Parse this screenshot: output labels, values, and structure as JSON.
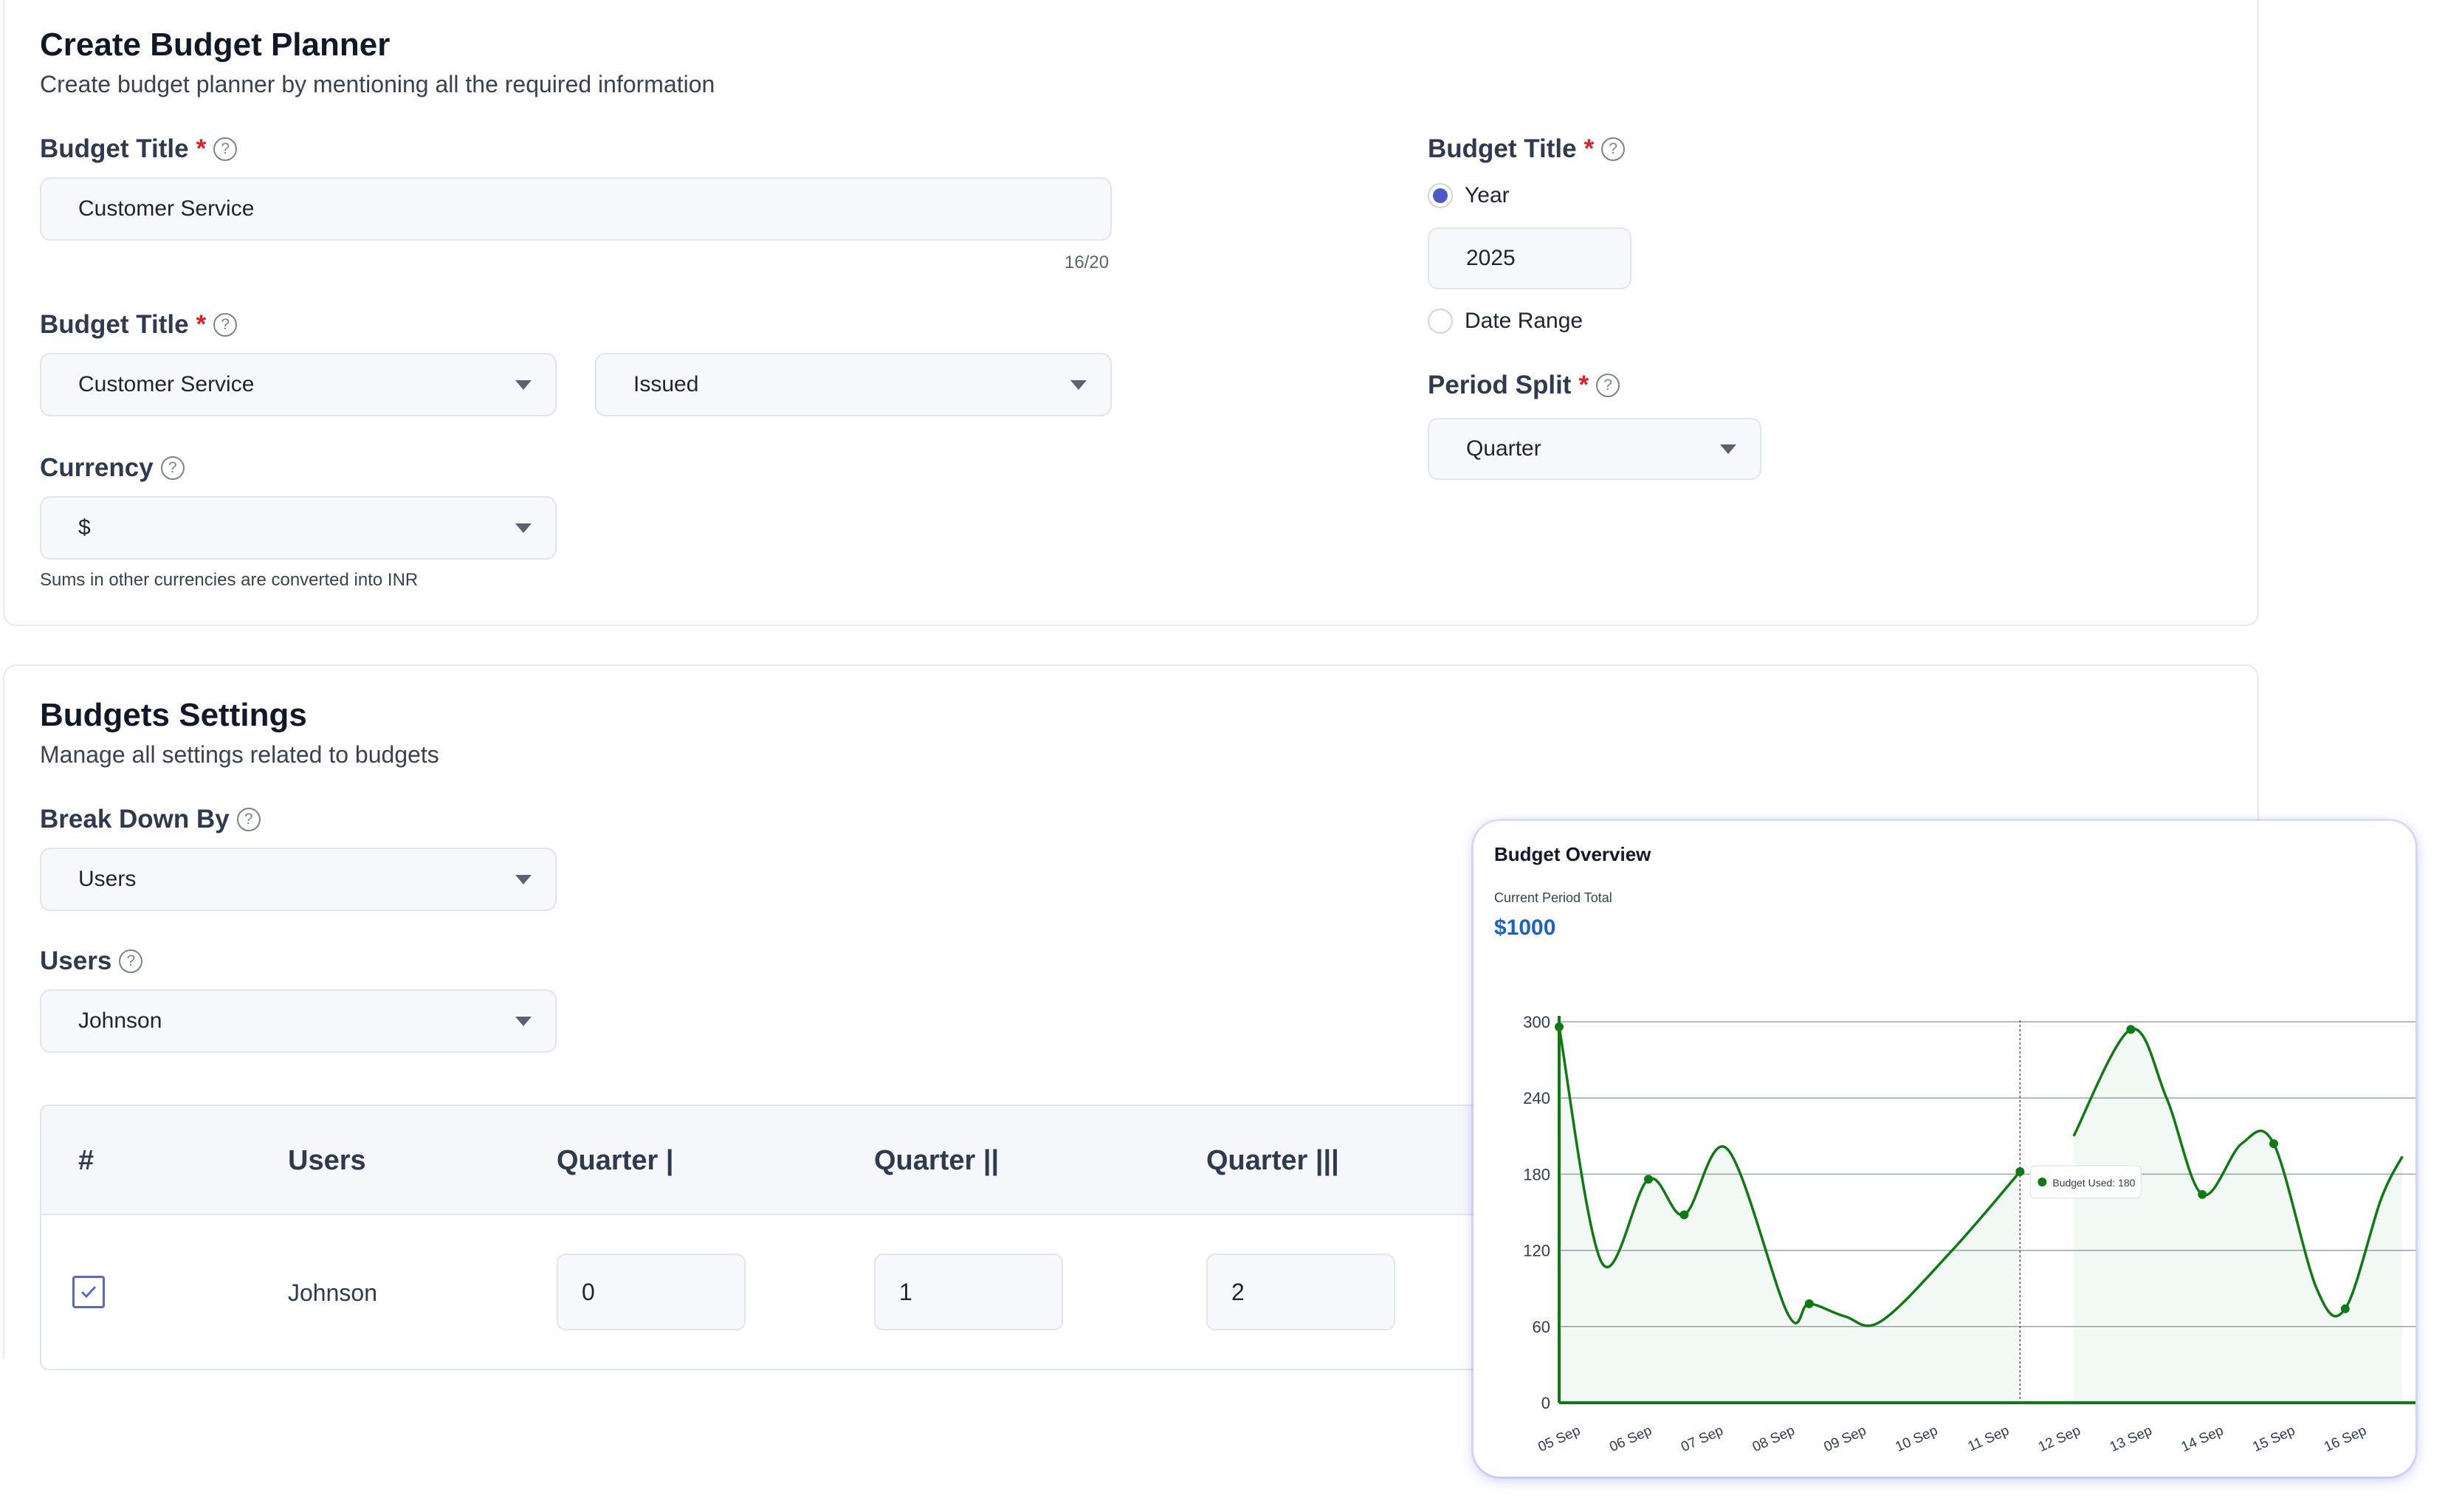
{
  "planner": {
    "title": "Create Budget Planner",
    "subtitle": "Create budget planner by mentioning all the required information",
    "budget_title_label": "Budget Title",
    "required_mark": "*",
    "help_glyph": "?",
    "budget_title_value": "Customer Service",
    "char_counter": "16/20",
    "budget_title2_label": "Budget Title",
    "department_select": "Customer Service",
    "status_select": "Issued",
    "currency_label": "Currency",
    "currency_select": "$",
    "currency_note": "Sums in other currencies are converted into INR",
    "right_title_label": "Budget Title",
    "radio_year_label": "Year",
    "year_value": "2025",
    "radio_range_label": "Date Range",
    "period_split_label": "Period Split",
    "period_split_select": "Quarter"
  },
  "settings": {
    "title": "Budgets Settings",
    "subtitle": "Manage all settings related to budgets",
    "breakdown_label": "Break Down By",
    "breakdown_select": "Users",
    "users_label": "Users",
    "users_select": "Johnson",
    "table": {
      "headers": [
        "#",
        "Users",
        "Quarter |",
        "Quarter ||",
        "Quarter |||"
      ],
      "rows": [
        {
          "checked": true,
          "user": "Johnson",
          "q1": "0",
          "q2": "1",
          "q3": "2"
        }
      ]
    }
  },
  "overview": {
    "title": "Budget Overview",
    "subtitle": "Current Period Total",
    "total": "$1000",
    "tooltip": "Budget Used: 180"
  },
  "colors": {
    "accent": "#4b59c9",
    "required": "#e11d2a",
    "total_blue": "#1c62c4",
    "line_green": "#0f7a12"
  },
  "chart_data": {
    "type": "line",
    "title": "Budget Overview",
    "categories": [
      "05 Sep",
      "06 Sep",
      "07 Sep",
      "08 Sep",
      "09 Sep",
      "10 Sep",
      "11 Sep",
      "12 Sep",
      "13 Sep",
      "14 Sep",
      "15 Sep",
      "16 Sep"
    ],
    "series": [
      {
        "x": [
          "05 Sep",
          "06 Sep",
          "06.4 Sep",
          "08.6 Sep",
          "11 Sep",
          "13 Sep",
          "14 Sep",
          "14.7 Sep",
          "16 Sep"
        ]
      }
    ],
    "points": [
      {
        "x": 0,
        "y": 296
      },
      {
        "x": 1.25,
        "y": 176
      },
      {
        "x": 1.75,
        "y": 148
      },
      {
        "x": 3.5,
        "y": 78
      },
      {
        "x": 6.45,
        "y": 182
      },
      {
        "x": 8,
        "y": 294
      },
      {
        "x": 9,
        "y": 164
      },
      {
        "x": 10,
        "y": 204
      },
      {
        "x": 11,
        "y": 74
      }
    ],
    "curve": [
      [
        0,
        296
      ],
      [
        0.6,
        110
      ],
      [
        1.25,
        176
      ],
      [
        1.75,
        148
      ],
      [
        2.35,
        200
      ],
      [
        3.2,
        70
      ],
      [
        3.5,
        78
      ],
      [
        4.0,
        68
      ],
      [
        4.5,
        64
      ],
      [
        5.5,
        120
      ],
      [
        6.45,
        182
      ],
      null,
      [
        7.2,
        210
      ],
      [
        8,
        294
      ],
      [
        8.5,
        240
      ],
      [
        9,
        164
      ],
      [
        9.55,
        204
      ],
      [
        10,
        204
      ],
      [
        10.6,
        90
      ],
      [
        11,
        74
      ],
      [
        11.5,
        160
      ],
      [
        11.8,
        194
      ]
    ],
    "tooltip_x": 6.45,
    "yticks": [
      0,
      60,
      120,
      180,
      240,
      300
    ],
    "ylim": [
      0,
      300
    ],
    "xlabel": "",
    "ylabel": "",
    "grid": true
  }
}
